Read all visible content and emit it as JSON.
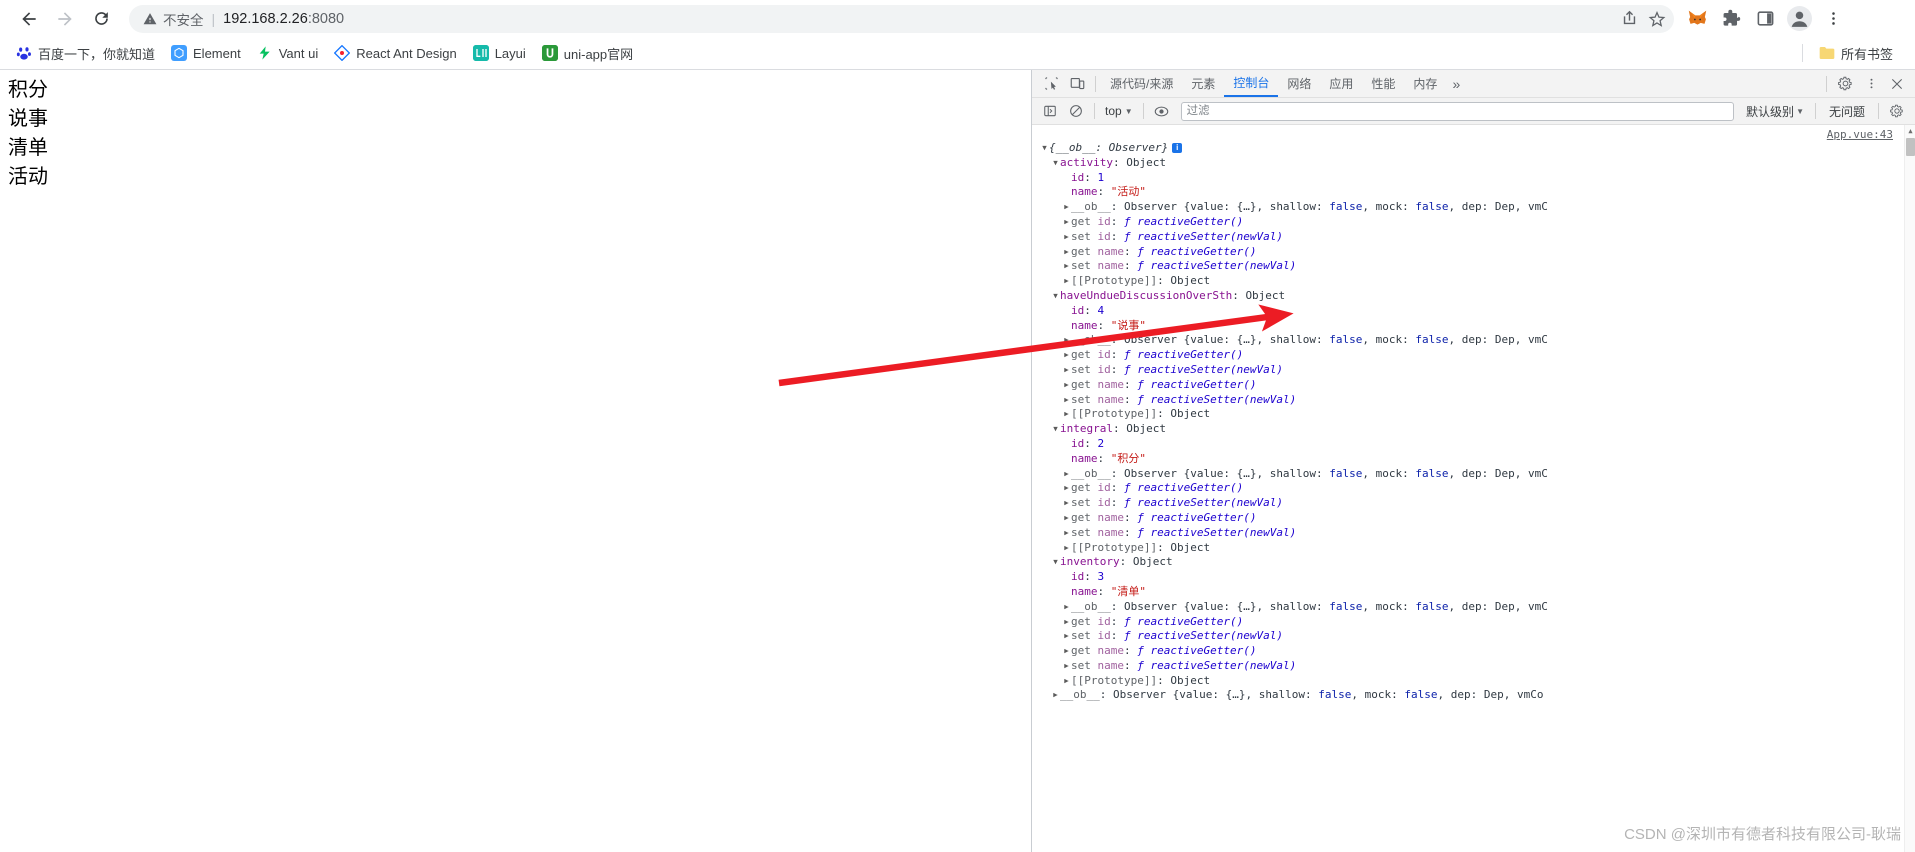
{
  "browser": {
    "nav": {
      "back_title": "后退",
      "forward_title": "前进",
      "reload_title": "重新加载"
    },
    "omnibox": {
      "security_label": "不安全",
      "security_icon": "warning-triangle-icon",
      "url_host": "192.168.2.26",
      "url_port": ":8080",
      "share_icon": "share-icon",
      "bookmark_icon": "star-icon"
    },
    "toolbar_icons": [
      {
        "name": "metamask-extension-icon",
        "label": "MetaMask"
      },
      {
        "name": "extensions-puzzle-icon",
        "label": "扩展程序"
      },
      {
        "name": "side-panel-icon",
        "label": "侧边栏"
      },
      {
        "name": "profile-avatar-icon",
        "label": "个人资料"
      },
      {
        "name": "chrome-menu-icon",
        "label": "自定义及控制"
      }
    ]
  },
  "bookmarks": {
    "items": [
      {
        "label": "百度一下，你就知道",
        "icon": "baidu-paw-icon",
        "color": "#2932e1",
        "glyph": "✿"
      },
      {
        "label": "Element",
        "icon": "element-ui-icon",
        "color": "#409eff",
        "glyph": "E"
      },
      {
        "label": "Vant ui",
        "icon": "vant-ui-icon",
        "color": "#07c160",
        "glyph": "V"
      },
      {
        "label": "React Ant Design",
        "icon": "ant-design-icon",
        "color": "#1677ff",
        "glyph": "◆"
      },
      {
        "label": "Layui",
        "icon": "layui-icon",
        "color": "#16baaa",
        "glyph": "L"
      },
      {
        "label": "uni-app官网",
        "icon": "uniapp-icon",
        "color": "#2b9939",
        "glyph": "U"
      }
    ],
    "all_bookmarks_label": "所有书签",
    "all_bookmarks_icon": "folder-icon"
  },
  "page": {
    "lines": [
      "积分",
      "说事",
      "清单",
      "活动"
    ]
  },
  "devtools": {
    "left_icons": [
      {
        "name": "inspect-element-icon"
      },
      {
        "name": "device-toolbar-icon"
      }
    ],
    "tabs": [
      {
        "label": "源代码/来源",
        "name": "tab-sources",
        "active": false
      },
      {
        "label": "元素",
        "name": "tab-elements",
        "active": false
      },
      {
        "label": "控制台",
        "name": "tab-console",
        "active": true
      },
      {
        "label": "网络",
        "name": "tab-network",
        "active": false
      },
      {
        "label": "应用",
        "name": "tab-application",
        "active": false
      },
      {
        "label": "性能",
        "name": "tab-performance",
        "active": false
      },
      {
        "label": "内存",
        "name": "tab-memory",
        "active": false
      }
    ],
    "more_tabs_label": "»",
    "settings_icon": "gear-icon",
    "kebab_icon": "kebab-menu-icon",
    "close_icon": "close-icon",
    "console_toolbar": {
      "sidebar_icon": "console-sidebar-icon",
      "clear_icon": "clear-console-icon",
      "context": "top",
      "eye_icon": "live-expression-icon",
      "filter_placeholder": "过滤",
      "filter_value": "",
      "level_label": "默认级别",
      "issues_label": "无问题",
      "settings_icon": "console-settings-icon"
    },
    "source_link": "App.vue:43",
    "log_rows": [
      {
        "indent": 0,
        "tri": "open",
        "tokens": [
          {
            "t": "{__ob__: Observer}",
            "c": "tk-italic"
          }
        ],
        "badge": true
      },
      {
        "indent": 1,
        "tri": "open",
        "tokens": [
          {
            "t": "activity",
            "c": "tk-prop"
          },
          {
            "t": ": ",
            "c": "tk-plain"
          },
          {
            "t": "Object",
            "c": "tk-objname"
          }
        ]
      },
      {
        "indent": 2,
        "tri": "none",
        "tokens": [
          {
            "t": "id",
            "c": "tk-prop"
          },
          {
            "t": ": ",
            "c": "tk-plain"
          },
          {
            "t": "1",
            "c": "tk-num"
          }
        ]
      },
      {
        "indent": 2,
        "tri": "none",
        "tokens": [
          {
            "t": "name",
            "c": "tk-prop"
          },
          {
            "t": ": ",
            "c": "tk-plain"
          },
          {
            "t": "\"活动\"",
            "c": "tk-str"
          }
        ]
      },
      {
        "indent": 2,
        "tri": "closed",
        "tokens": [
          {
            "t": "__ob__",
            "c": "tk-grey"
          },
          {
            "t": ": Observer {value: {…}, shallow: ",
            "c": "tk-plain"
          },
          {
            "t": "false",
            "c": "tk-bool"
          },
          {
            "t": ", mock: ",
            "c": "tk-plain"
          },
          {
            "t": "false",
            "c": "tk-bool"
          },
          {
            "t": ", dep: Dep, vmC",
            "c": "tk-plain"
          }
        ]
      },
      {
        "indent": 2,
        "tri": "closed",
        "tokens": [
          {
            "t": "get ",
            "c": "tk-grey"
          },
          {
            "t": "id",
            "c": "tk-accessor"
          },
          {
            "t": ": ",
            "c": "tk-plain"
          },
          {
            "t": "ƒ reactiveGetter()",
            "c": "tk-fn"
          }
        ]
      },
      {
        "indent": 2,
        "tri": "closed",
        "tokens": [
          {
            "t": "set ",
            "c": "tk-grey"
          },
          {
            "t": "id",
            "c": "tk-accessor"
          },
          {
            "t": ": ",
            "c": "tk-plain"
          },
          {
            "t": "ƒ reactiveSetter(newVal)",
            "c": "tk-fn"
          }
        ]
      },
      {
        "indent": 2,
        "tri": "closed",
        "tokens": [
          {
            "t": "get ",
            "c": "tk-grey"
          },
          {
            "t": "name",
            "c": "tk-accessor"
          },
          {
            "t": ": ",
            "c": "tk-plain"
          },
          {
            "t": "ƒ reactiveGetter()",
            "c": "tk-fn"
          }
        ]
      },
      {
        "indent": 2,
        "tri": "closed",
        "tokens": [
          {
            "t": "set ",
            "c": "tk-grey"
          },
          {
            "t": "name",
            "c": "tk-accessor"
          },
          {
            "t": ": ",
            "c": "tk-plain"
          },
          {
            "t": "ƒ reactiveSetter(newVal)",
            "c": "tk-fn"
          }
        ]
      },
      {
        "indent": 2,
        "tri": "closed",
        "tokens": [
          {
            "t": "[[Prototype]]",
            "c": "tk-proto"
          },
          {
            "t": ": Object",
            "c": "tk-plain"
          }
        ]
      },
      {
        "indent": 1,
        "tri": "open",
        "tokens": [
          {
            "t": "haveUndueDiscussionOverSth",
            "c": "tk-prop"
          },
          {
            "t": ": ",
            "c": "tk-plain"
          },
          {
            "t": "Object",
            "c": "tk-objname"
          }
        ]
      },
      {
        "indent": 2,
        "tri": "none",
        "tokens": [
          {
            "t": "id",
            "c": "tk-prop"
          },
          {
            "t": ": ",
            "c": "tk-plain"
          },
          {
            "t": "4",
            "c": "tk-num"
          }
        ]
      },
      {
        "indent": 2,
        "tri": "none",
        "tokens": [
          {
            "t": "name",
            "c": "tk-prop"
          },
          {
            "t": ": ",
            "c": "tk-plain"
          },
          {
            "t": "\"说事\"",
            "c": "tk-str"
          }
        ]
      },
      {
        "indent": 2,
        "tri": "closed",
        "tokens": [
          {
            "t": "__ob__",
            "c": "tk-grey"
          },
          {
            "t": ": Observer {value: {…}, shallow: ",
            "c": "tk-plain"
          },
          {
            "t": "false",
            "c": "tk-bool"
          },
          {
            "t": ", mock: ",
            "c": "tk-plain"
          },
          {
            "t": "false",
            "c": "tk-bool"
          },
          {
            "t": ", dep: Dep, vmC",
            "c": "tk-plain"
          }
        ]
      },
      {
        "indent": 2,
        "tri": "closed",
        "tokens": [
          {
            "t": "get ",
            "c": "tk-grey"
          },
          {
            "t": "id",
            "c": "tk-accessor"
          },
          {
            "t": ": ",
            "c": "tk-plain"
          },
          {
            "t": "ƒ reactiveGetter()",
            "c": "tk-fn"
          }
        ]
      },
      {
        "indent": 2,
        "tri": "closed",
        "tokens": [
          {
            "t": "set ",
            "c": "tk-grey"
          },
          {
            "t": "id",
            "c": "tk-accessor"
          },
          {
            "t": ": ",
            "c": "tk-plain"
          },
          {
            "t": "ƒ reactiveSetter(newVal)",
            "c": "tk-fn"
          }
        ]
      },
      {
        "indent": 2,
        "tri": "closed",
        "tokens": [
          {
            "t": "get ",
            "c": "tk-grey"
          },
          {
            "t": "name",
            "c": "tk-accessor"
          },
          {
            "t": ": ",
            "c": "tk-plain"
          },
          {
            "t": "ƒ reactiveGetter()",
            "c": "tk-fn"
          }
        ]
      },
      {
        "indent": 2,
        "tri": "closed",
        "tokens": [
          {
            "t": "set ",
            "c": "tk-grey"
          },
          {
            "t": "name",
            "c": "tk-accessor"
          },
          {
            "t": ": ",
            "c": "tk-plain"
          },
          {
            "t": "ƒ reactiveSetter(newVal)",
            "c": "tk-fn"
          }
        ]
      },
      {
        "indent": 2,
        "tri": "closed",
        "tokens": [
          {
            "t": "[[Prototype]]",
            "c": "tk-proto"
          },
          {
            "t": ": Object",
            "c": "tk-plain"
          }
        ]
      },
      {
        "indent": 1,
        "tri": "open",
        "tokens": [
          {
            "t": "integral",
            "c": "tk-prop"
          },
          {
            "t": ": ",
            "c": "tk-plain"
          },
          {
            "t": "Object",
            "c": "tk-objname"
          }
        ]
      },
      {
        "indent": 2,
        "tri": "none",
        "tokens": [
          {
            "t": "id",
            "c": "tk-prop"
          },
          {
            "t": ": ",
            "c": "tk-plain"
          },
          {
            "t": "2",
            "c": "tk-num"
          }
        ]
      },
      {
        "indent": 2,
        "tri": "none",
        "tokens": [
          {
            "t": "name",
            "c": "tk-prop"
          },
          {
            "t": ": ",
            "c": "tk-plain"
          },
          {
            "t": "\"积分\"",
            "c": "tk-str"
          }
        ]
      },
      {
        "indent": 2,
        "tri": "closed",
        "tokens": [
          {
            "t": "__ob__",
            "c": "tk-grey"
          },
          {
            "t": ": Observer {value: {…}, shallow: ",
            "c": "tk-plain"
          },
          {
            "t": "false",
            "c": "tk-bool"
          },
          {
            "t": ", mock: ",
            "c": "tk-plain"
          },
          {
            "t": "false",
            "c": "tk-bool"
          },
          {
            "t": ", dep: Dep, vmC",
            "c": "tk-plain"
          }
        ]
      },
      {
        "indent": 2,
        "tri": "closed",
        "tokens": [
          {
            "t": "get ",
            "c": "tk-grey"
          },
          {
            "t": "id",
            "c": "tk-accessor"
          },
          {
            "t": ": ",
            "c": "tk-plain"
          },
          {
            "t": "ƒ reactiveGetter()",
            "c": "tk-fn"
          }
        ]
      },
      {
        "indent": 2,
        "tri": "closed",
        "tokens": [
          {
            "t": "set ",
            "c": "tk-grey"
          },
          {
            "t": "id",
            "c": "tk-accessor"
          },
          {
            "t": ": ",
            "c": "tk-plain"
          },
          {
            "t": "ƒ reactiveSetter(newVal)",
            "c": "tk-fn"
          }
        ]
      },
      {
        "indent": 2,
        "tri": "closed",
        "tokens": [
          {
            "t": "get ",
            "c": "tk-grey"
          },
          {
            "t": "name",
            "c": "tk-accessor"
          },
          {
            "t": ": ",
            "c": "tk-plain"
          },
          {
            "t": "ƒ reactiveGetter()",
            "c": "tk-fn"
          }
        ]
      },
      {
        "indent": 2,
        "tri": "closed",
        "tokens": [
          {
            "t": "set ",
            "c": "tk-grey"
          },
          {
            "t": "name",
            "c": "tk-accessor"
          },
          {
            "t": ": ",
            "c": "tk-plain"
          },
          {
            "t": "ƒ reactiveSetter(newVal)",
            "c": "tk-fn"
          }
        ]
      },
      {
        "indent": 2,
        "tri": "closed",
        "tokens": [
          {
            "t": "[[Prototype]]",
            "c": "tk-proto"
          },
          {
            "t": ": Object",
            "c": "tk-plain"
          }
        ]
      },
      {
        "indent": 1,
        "tri": "open",
        "tokens": [
          {
            "t": "inventory",
            "c": "tk-prop"
          },
          {
            "t": ": ",
            "c": "tk-plain"
          },
          {
            "t": "Object",
            "c": "tk-objname"
          }
        ]
      },
      {
        "indent": 2,
        "tri": "none",
        "tokens": [
          {
            "t": "id",
            "c": "tk-prop"
          },
          {
            "t": ": ",
            "c": "tk-plain"
          },
          {
            "t": "3",
            "c": "tk-num"
          }
        ]
      },
      {
        "indent": 2,
        "tri": "none",
        "tokens": [
          {
            "t": "name",
            "c": "tk-prop"
          },
          {
            "t": ": ",
            "c": "tk-plain"
          },
          {
            "t": "\"清单\"",
            "c": "tk-str"
          }
        ]
      },
      {
        "indent": 2,
        "tri": "closed",
        "tokens": [
          {
            "t": "__ob__",
            "c": "tk-grey"
          },
          {
            "t": ": Observer {value: {…}, shallow: ",
            "c": "tk-plain"
          },
          {
            "t": "false",
            "c": "tk-bool"
          },
          {
            "t": ", mock: ",
            "c": "tk-plain"
          },
          {
            "t": "false",
            "c": "tk-bool"
          },
          {
            "t": ", dep: Dep, vmC",
            "c": "tk-plain"
          }
        ]
      },
      {
        "indent": 2,
        "tri": "closed",
        "tokens": [
          {
            "t": "get ",
            "c": "tk-grey"
          },
          {
            "t": "id",
            "c": "tk-accessor"
          },
          {
            "t": ": ",
            "c": "tk-plain"
          },
          {
            "t": "ƒ reactiveGetter()",
            "c": "tk-fn"
          }
        ]
      },
      {
        "indent": 2,
        "tri": "closed",
        "tokens": [
          {
            "t": "set ",
            "c": "tk-grey"
          },
          {
            "t": "id",
            "c": "tk-accessor"
          },
          {
            "t": ": ",
            "c": "tk-plain"
          },
          {
            "t": "ƒ reactiveSetter(newVal)",
            "c": "tk-fn"
          }
        ]
      },
      {
        "indent": 2,
        "tri": "closed",
        "tokens": [
          {
            "t": "get ",
            "c": "tk-grey"
          },
          {
            "t": "name",
            "c": "tk-accessor"
          },
          {
            "t": ": ",
            "c": "tk-plain"
          },
          {
            "t": "ƒ reactiveGetter()",
            "c": "tk-fn"
          }
        ]
      },
      {
        "indent": 2,
        "tri": "closed",
        "tokens": [
          {
            "t": "set ",
            "c": "tk-grey"
          },
          {
            "t": "name",
            "c": "tk-accessor"
          },
          {
            "t": ": ",
            "c": "tk-plain"
          },
          {
            "t": "ƒ reactiveSetter(newVal)",
            "c": "tk-fn"
          }
        ]
      },
      {
        "indent": 2,
        "tri": "closed",
        "tokens": [
          {
            "t": "[[Prototype]]",
            "c": "tk-proto"
          },
          {
            "t": ": Object",
            "c": "tk-plain"
          }
        ]
      },
      {
        "indent": 1,
        "tri": "closed",
        "tokens": [
          {
            "t": "__ob__",
            "c": "tk-grey"
          },
          {
            "t": ": Observer {value: {…}, shallow: ",
            "c": "tk-plain"
          },
          {
            "t": "false",
            "c": "tk-bool"
          },
          {
            "t": ", mock: ",
            "c": "tk-plain"
          },
          {
            "t": "false",
            "c": "tk-bool"
          },
          {
            "t": ", dep: Dep, vmCo",
            "c": "tk-plain"
          }
        ]
      }
    ]
  },
  "annotation": {
    "arrow_color": "#ec1c24",
    "arrow_name": "red-pointer-arrow"
  },
  "watermark": {
    "text": "CSDN @深圳市有德者科技有限公司-耿瑞"
  }
}
